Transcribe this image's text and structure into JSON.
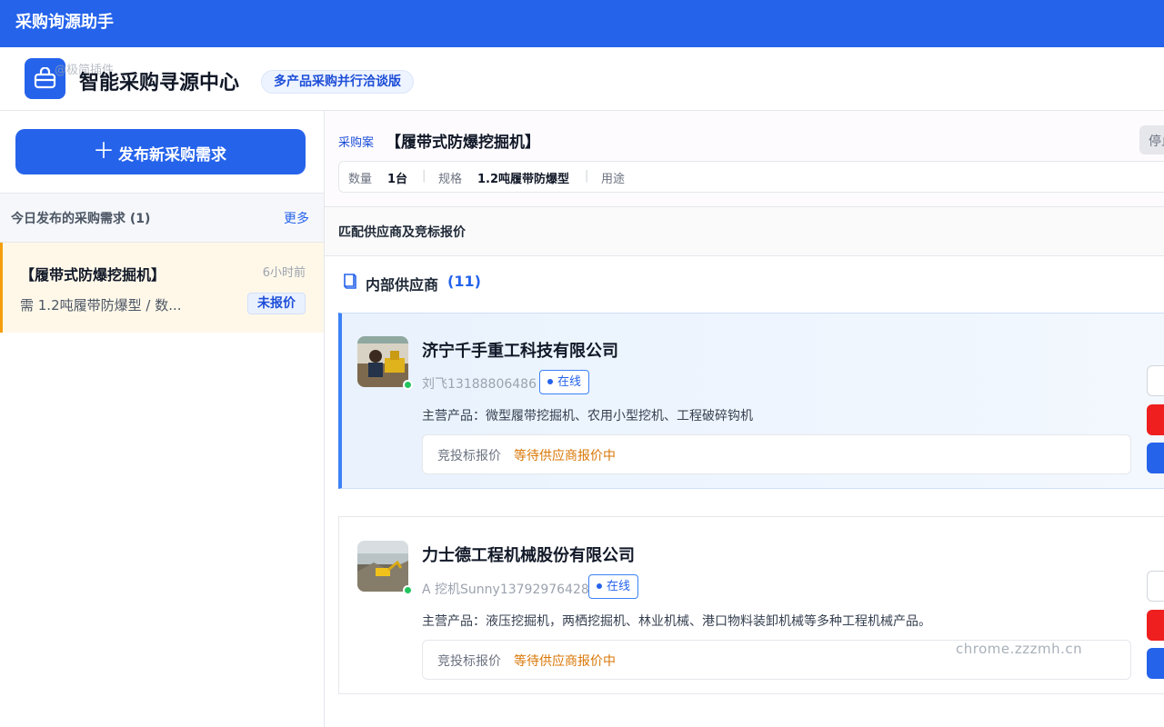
{
  "topbar": {
    "title": "采购询源助手"
  },
  "header": {
    "watermark": "@极简插件",
    "title": "智能采购寻源中心",
    "badge": "多产品采购并行洽谈版"
  },
  "sidebar": {
    "new_button_label": "发布新采购需求",
    "today_title": "今日发布的采购需求 (1)",
    "more_label": "更多",
    "requests": [
      {
        "title": "【履带式防爆挖掘机】",
        "time": "6小时前",
        "desc": "需 1.2吨履带防爆型 / 数...",
        "status": "未报价"
      }
    ]
  },
  "case": {
    "label": "采购案",
    "title": "【履带式防爆挖掘机】",
    "stop_label": "停止",
    "specs": {
      "qty_key": "数量",
      "qty_val": "1台",
      "spec_key": "规格",
      "spec_val": "1.2吨履带防爆型",
      "use_key": "用途"
    }
  },
  "match": {
    "title": "匹配供应商及竞标报价"
  },
  "group": {
    "title": "内部供应商",
    "count": "(11)"
  },
  "suppliers": [
    {
      "company": "济宁千手重工科技有限公司",
      "contact": "刘飞13188806486",
      "online": "在线",
      "products": "主营产品：微型履带挖掘机、农用小型挖机、工程破碎钩机",
      "bid_label": "竞投标报价",
      "bid_status": "等待供应商报价中"
    },
    {
      "company": "力士德工程机械股份有限公司",
      "contact": "A 挖机Sunny13792976428",
      "online": "在线",
      "products": "主营产品：液压挖掘机，两栖挖掘机、林业机械、港口物料装卸机械等多种工程机械产品。",
      "bid_label": "竞投标报价",
      "bid_status": "等待供应商报价中"
    }
  ],
  "watermark_footer": "chrome.zzzmh.cn",
  "colors": {
    "primary": "#2563eb",
    "warning": "#d97706",
    "online": "#22c55e",
    "danger": "#ef1f1f"
  }
}
